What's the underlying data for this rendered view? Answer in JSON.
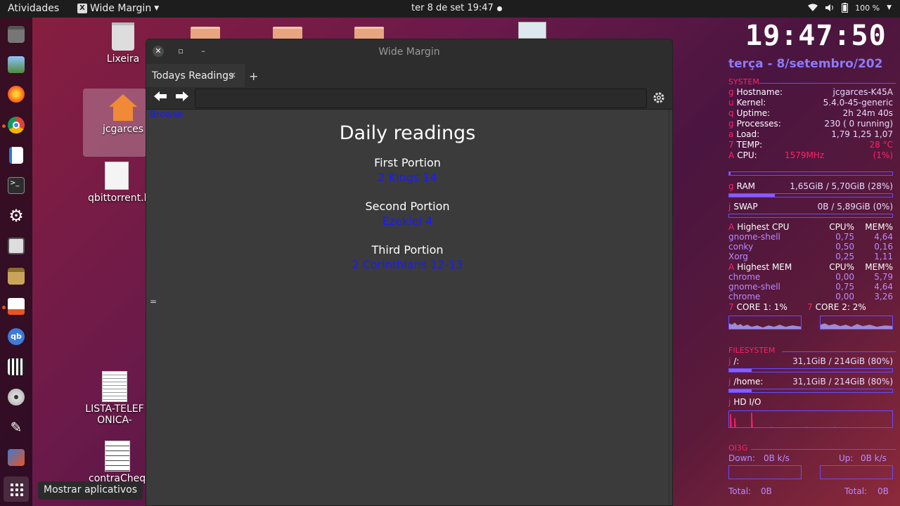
{
  "topbar": {
    "activities": "Atividades",
    "app_name": "Wide Margin",
    "app_icon_letter": "X",
    "clock": "ter 8 de set  19:47",
    "battery": "100 %"
  },
  "dock": {
    "tooltip": "Mostrar aplicativos",
    "items": [
      "files-icon",
      "image-viewer-icon",
      "firefox-icon",
      "chrome-icon",
      "writer-icon",
      "terminal-icon",
      "settings-icon",
      "screen-settings-icon",
      "archive-icon",
      "software-store-icon",
      "qbittorrent-icon",
      "video-editor-icon",
      "disc-icon",
      "inkscape-icon",
      "app-icon"
    ]
  },
  "desktop": {
    "trash_label": "Lixeira",
    "home_label": "jcgarces",
    "file1_label": "qbittorrent.l",
    "file2_label": "LISTA-TELEFONICA-",
    "file3_label": "contraCheque"
  },
  "window": {
    "title": "Wide Margin",
    "tab_label": "Todays Readings",
    "new_tab_label": "+",
    "url_value": "",
    "browse_link": "Browse",
    "eq_glyph": "=",
    "heading": "Daily readings",
    "portions": [
      {
        "label": "First Portion",
        "link": "2 Kings 14"
      },
      {
        "label": "Second Portion",
        "link": "Ezekiel 4"
      },
      {
        "label": "Third Portion",
        "link": "2 Corinthians 12-13"
      }
    ]
  },
  "conky": {
    "time": "19:47:50",
    "date": "terça -  8/setembro/202",
    "system_title": "SYSTEM",
    "hostname_label": "Hostname:",
    "hostname": "jcgarces-K45A",
    "kernel_label": "Kernel:",
    "kernel": "5.4.0-45-generic",
    "uptime_label": "Uptime:",
    "uptime": "2h 24m 40s",
    "processes_label": "Processes:",
    "processes": "230 (   0 running)",
    "load_label": "Load:",
    "load": "1,79 1,25 1,07",
    "temp_label": "TEMP:",
    "temp": "28 °C",
    "cpu_label": "CPU:",
    "cpu_freq": "1579MHz",
    "cpu_pct": "(1%)",
    "cpu_usage": 0.01,
    "ram_label": "RAM",
    "ram": "1,65GiB / 5,70GiB (28%)",
    "ram_usage": 0.28,
    "swap_label": "SWAP",
    "swap": "0B   / 5,89GiB (0%)",
    "swap_usage": 0.0,
    "highest_cpu_label": "Highest CPU",
    "cpu_col": "CPU%",
    "mem_col": "MEM%",
    "highest_cpu": [
      {
        "name": "gnome-shell",
        "cpu": "0,75",
        "mem": "4,64"
      },
      {
        "name": "conky",
        "cpu": "0,50",
        "mem": "0,16"
      },
      {
        "name": "Xorg",
        "cpu": "0,25",
        "mem": "1,11"
      }
    ],
    "highest_mem_label": "Highest MEM",
    "highest_mem": [
      {
        "name": "chrome",
        "cpu": "0,00",
        "mem": "5,79"
      },
      {
        "name": "gnome-shell",
        "cpu": "0,75",
        "mem": "4,64"
      },
      {
        "name": "chrome",
        "cpu": "0,00",
        "mem": "3,26"
      }
    ],
    "core1": "CORE 1:  1%",
    "core2": "CORE 2:  2%",
    "filesystem_title": "FILESYSTEM",
    "fs_root_label": "/:",
    "fs_root": "31,1GiB /  214GiB (80%)",
    "fs_root_usage": 0.14,
    "fs_home_label": "/home:",
    "fs_home": "31,1GiB /  214GiB (80%)",
    "fs_home_usage": 0.14,
    "hdio_label": "HD  I/O",
    "net_title": "OI3G",
    "down_label": "Down:",
    "down": "0B   k/s",
    "up_label": "Up:",
    "up": "0B   k/s",
    "total_label": "Total:",
    "total_down": "0B",
    "total_up": "0B",
    "glyphs": {
      "g": "g",
      "u": "u",
      "q": "q",
      "a": "a",
      "seven": "7",
      "A": "A",
      "j": "j"
    }
  },
  "colors": {
    "accent_blue_link": "#1a1aff",
    "conky_red": "#ff2266",
    "conky_purple": "#8b7bff"
  }
}
